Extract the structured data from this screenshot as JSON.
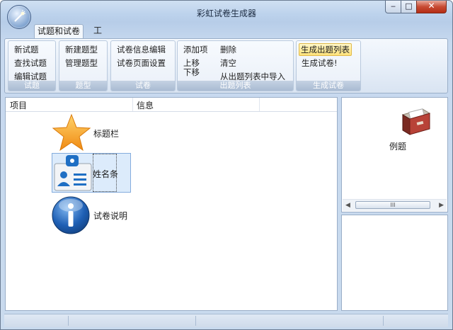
{
  "window": {
    "title": "彩虹试卷生成器",
    "controls": {
      "minimize": "‒",
      "maximize": "□",
      "close": "✕"
    }
  },
  "tabs": [
    {
      "label": "试题和试卷",
      "active": true
    },
    {
      "label": "工具",
      "active": false
    }
  ],
  "ribbon": {
    "groups": [
      {
        "label": "试题",
        "buttons": [
          "新试题",
          "查找试题",
          "编辑试题"
        ]
      },
      {
        "label": "题型",
        "buttons": [
          "新建题型",
          "管理题型"
        ]
      },
      {
        "label": "试卷",
        "buttons": [
          "试卷信息编辑",
          "试卷页面设置"
        ]
      },
      {
        "label": "出题列表",
        "buttons": [
          "添加项",
          "上移",
          "下移",
          "删除",
          "清空",
          "从出题列表中导入"
        ]
      },
      {
        "label": "生成试卷",
        "buttons": [
          "生成出题列表",
          "生成试卷!"
        ]
      }
    ]
  },
  "list": {
    "columns": [
      "项目",
      "信息"
    ],
    "items": [
      {
        "label": "标题栏",
        "icon": "star-icon",
        "selected": false
      },
      {
        "label": "姓名条",
        "icon": "id-card-icon",
        "selected": true
      },
      {
        "label": "试卷说明",
        "icon": "info-icon",
        "selected": false
      }
    ]
  },
  "preview": {
    "label": "例题",
    "icon": "file-box-icon",
    "scroll_thumb": "III"
  },
  "colors": {
    "accent": "#3b6fb6",
    "selection": "#dcebfb",
    "star": "#f6a623",
    "info": "#1e5fb4"
  }
}
